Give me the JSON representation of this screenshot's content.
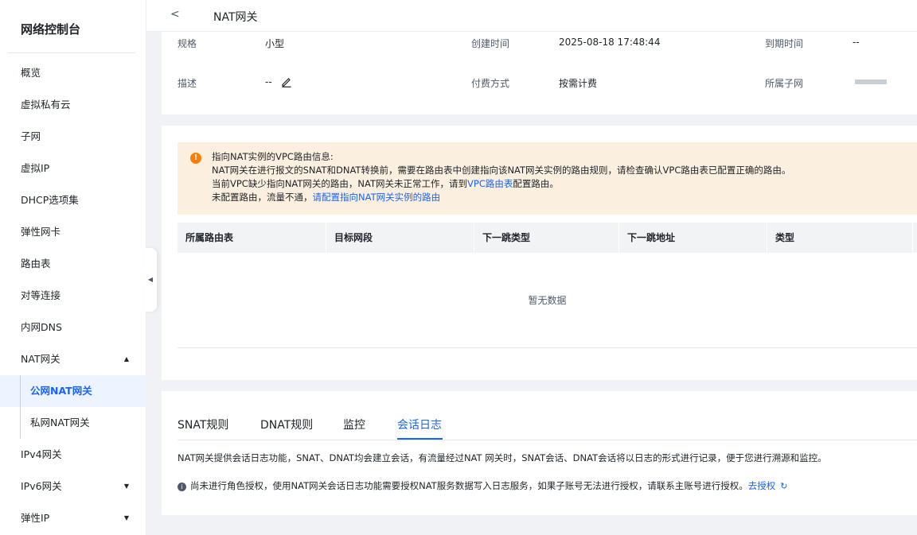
{
  "sidebar": {
    "title": "网络控制台",
    "items": [
      {
        "label": "概览"
      },
      {
        "label": "虚拟私有云"
      },
      {
        "label": "子网"
      },
      {
        "label": "虚拟IP"
      },
      {
        "label": "DHCP选项集"
      },
      {
        "label": "弹性网卡"
      },
      {
        "label": "路由表"
      },
      {
        "label": "对等连接"
      },
      {
        "label": "内网DNS"
      },
      {
        "label": "NAT网关",
        "expanded": true
      },
      {
        "label": "IPv4网关"
      },
      {
        "label": "IPv6网关"
      },
      {
        "label": "弹性IP"
      }
    ],
    "nat_sub": [
      {
        "label": "公网NAT网关",
        "active": true
      },
      {
        "label": "私网NAT网关"
      }
    ]
  },
  "header": {
    "title": "NAT网关"
  },
  "info": {
    "spec_label": "规格",
    "spec_value": "小型",
    "created_label": "创建时间",
    "created_value": "2025-08-18 17:48:44",
    "expire_label": "到期时间",
    "expire_value": "--",
    "desc_label": "描述",
    "desc_value": "--",
    "billing_label": "付费方式",
    "billing_value": "按需计费",
    "subnet_label": "所属子网"
  },
  "alert": {
    "title": "指向NAT实例的VPC路由信息:",
    "line1": "NAT网关在进行报文的SNAT和DNAT转换前，需要在路由表中创建指向该NAT网关实例的路由规则，请检查确认VPC路由表已配置正确的路由。",
    "line2_prefix": "当前VPC缺少指向NAT网关的路由，NAT网关未正常工作，请到",
    "line2_link": "VPC路由表",
    "line2_suffix": "配置路由。",
    "line3_prefix": "未配置路由，流量不通，",
    "line3_link": "请配置指向NAT网关实例的路由"
  },
  "route_table": {
    "columns": [
      "所属路由表",
      "目标网段",
      "下一跳类型",
      "下一跳地址",
      "类型"
    ],
    "empty_text": "暂无数据"
  },
  "tabs": {
    "items": [
      {
        "label": "SNAT规则"
      },
      {
        "label": "DNAT规则"
      },
      {
        "label": "监控"
      },
      {
        "label": "会话日志",
        "active": true
      }
    ],
    "description": "NAT网关提供会话日志功能，SNAT、DNAT均会建立会话，有流量经过NAT 网关时，SNAT会话、DNAT会话将以日志的形式进行记录，便于您进行溯源和监控。",
    "notice_text": "尚未进行角色授权，使用NAT网关会话日志功能需要授权NAT服务数据写入日志服务，如果子账号无法进行授权，请联系主账号进行授权。",
    "notice_link": "去授权"
  },
  "colors": {
    "accent": "#1664ff",
    "warning_bg": "#fbefdf",
    "warning_icon": "#ff7d00"
  }
}
